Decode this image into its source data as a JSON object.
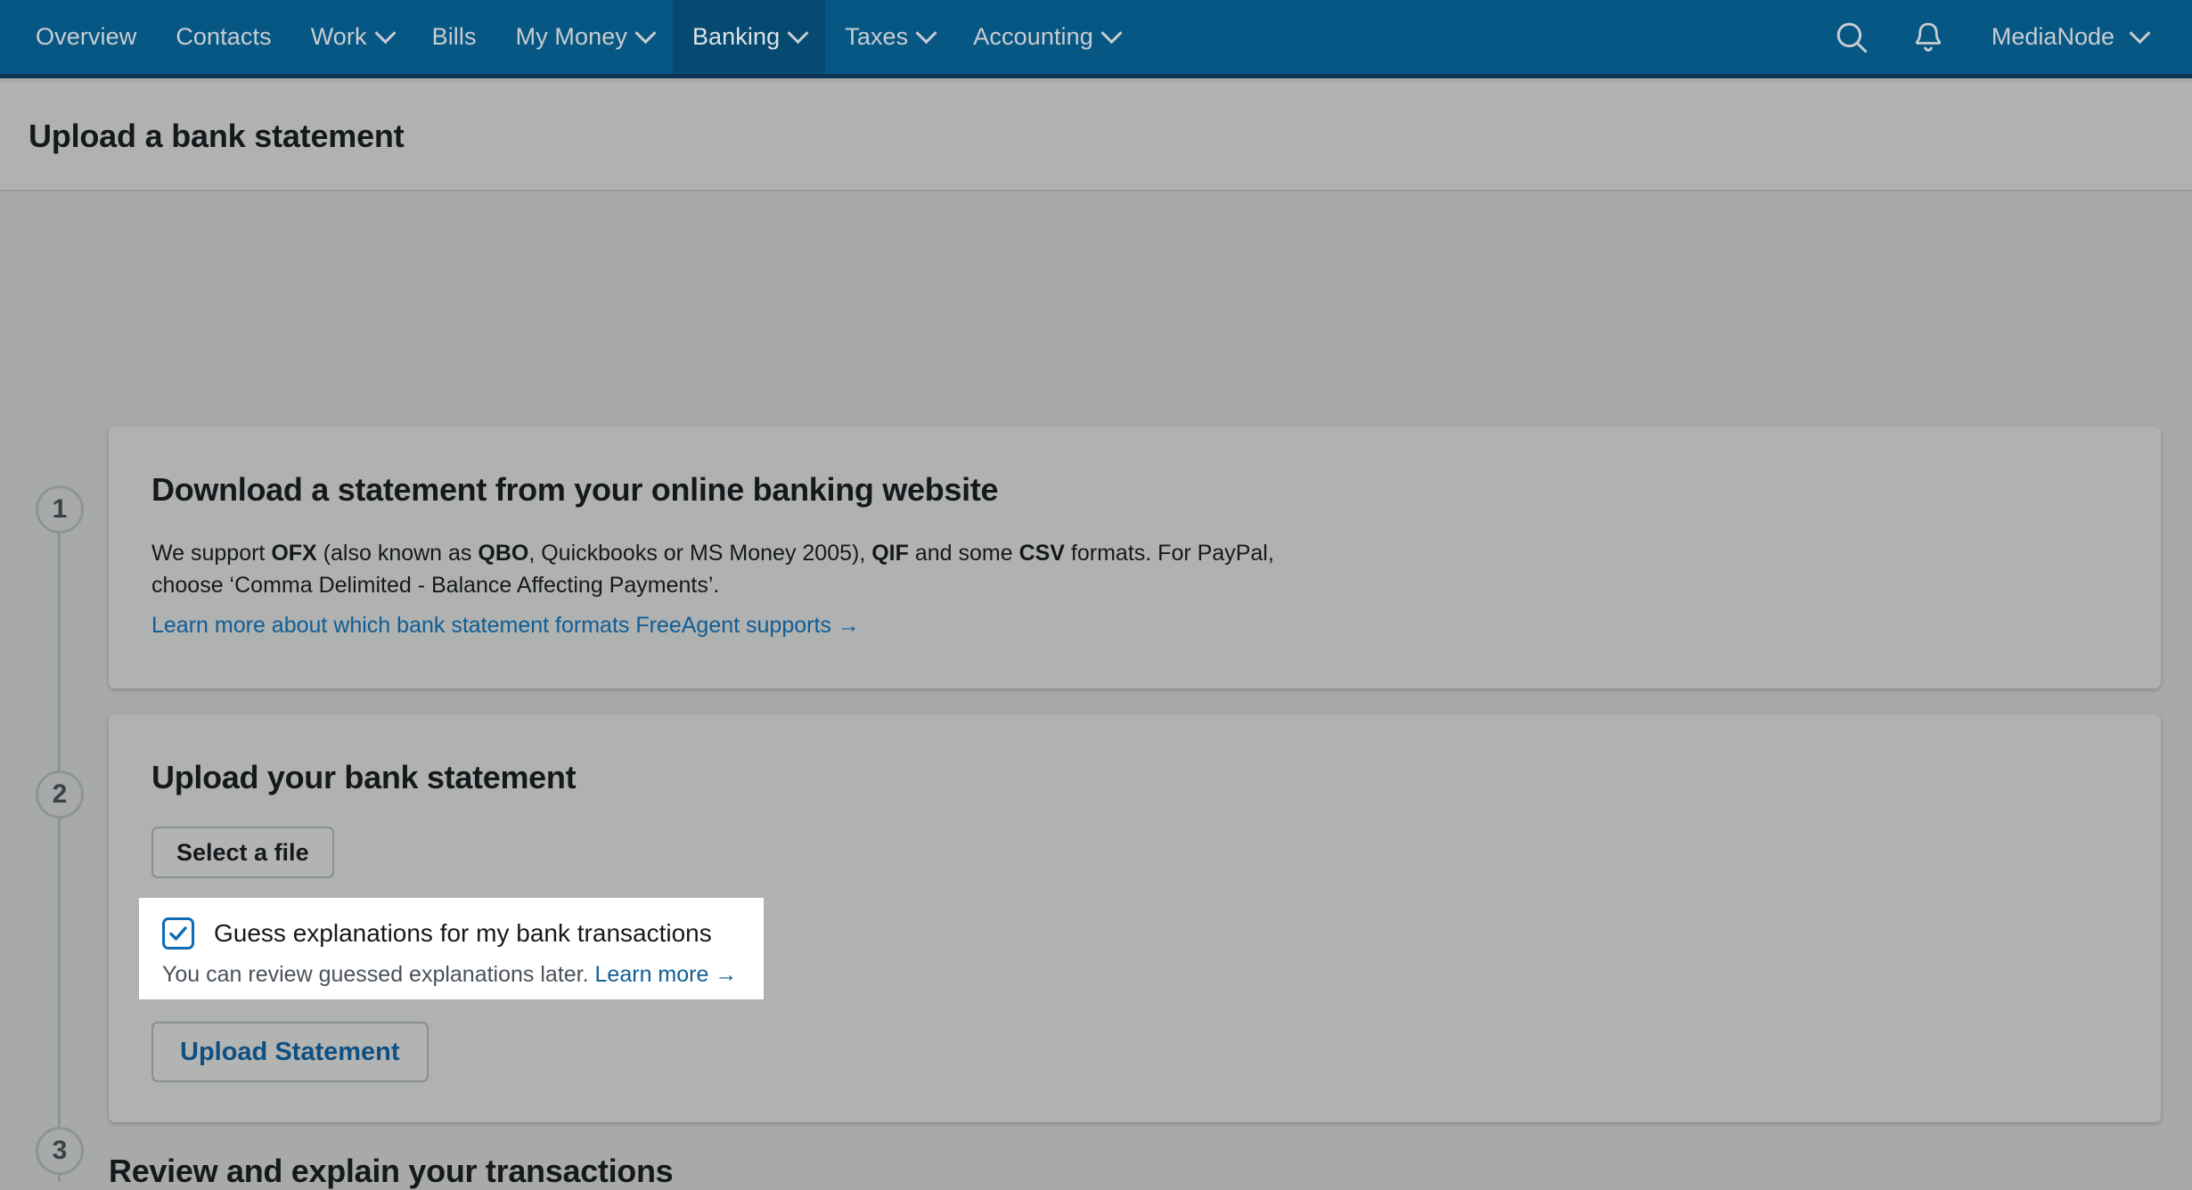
{
  "nav": {
    "items": [
      {
        "label": "Overview",
        "icon": "",
        "active": false,
        "has_caret": false
      },
      {
        "label": "Contacts",
        "icon": "",
        "active": false,
        "has_caret": false
      },
      {
        "label": "Work",
        "icon": "chevron-down-icon",
        "active": false,
        "has_caret": true
      },
      {
        "label": "Bills",
        "icon": "",
        "active": false,
        "has_caret": false
      },
      {
        "label": "My Money",
        "icon": "chevron-down-icon",
        "active": false,
        "has_caret": true
      },
      {
        "label": "Banking",
        "icon": "chevron-down-icon",
        "active": true,
        "has_caret": true
      },
      {
        "label": "Taxes",
        "icon": "chevron-down-icon",
        "active": false,
        "has_caret": true
      },
      {
        "label": "Accounting",
        "icon": "chevron-down-icon",
        "active": false,
        "has_caret": true
      }
    ],
    "search_icon": "search-icon",
    "notifications_icon": "bell-icon",
    "user_name": "MediaNode",
    "user_caret_icon": "chevron-down-icon",
    "bar_color": "#075784",
    "active_color": "#064a72",
    "text_color": "#c8cdd0"
  },
  "header": {
    "title": "Upload a bank statement"
  },
  "steps": [
    {
      "number": "1",
      "heading": "Download a statement from your online banking website",
      "body_prefix": "We support ",
      "body_b1": "OFX",
      "body_mid1": " (also known as ",
      "body_b2": "QBO",
      "body_mid2": ", Quickbooks or MS Money 2005), ",
      "body_b3": "QIF",
      "body_mid3": " and some ",
      "body_b4": "CSV",
      "body_suffix": " formats. For PayPal, choose ‘Comma Delimited - Balance Affecting Payments’.",
      "link_text": "Learn more about which bank statement formats FreeAgent supports →"
    },
    {
      "number": "2",
      "heading": "Upload your bank statement",
      "select_file_label": "Select a file",
      "upload_label": "Upload Statement"
    },
    {
      "number": "3",
      "heading": "Review and explain your transactions"
    }
  ],
  "guess_panel": {
    "checkbox_checked": true,
    "checkbox_icon": "checkmark-icon",
    "label": "Guess explanations for my bank transactions",
    "sub_text": "You can review guessed explanations later.",
    "sub_link": "Learn more →"
  },
  "colors": {
    "nav_blue": "#075784",
    "link_blue": "#0f5e96",
    "checkbox_blue": "#0b6db5",
    "page_bg": "#a8a9a9",
    "card_bg": "#b0b1b1",
    "panel_white": "#ffffff"
  }
}
